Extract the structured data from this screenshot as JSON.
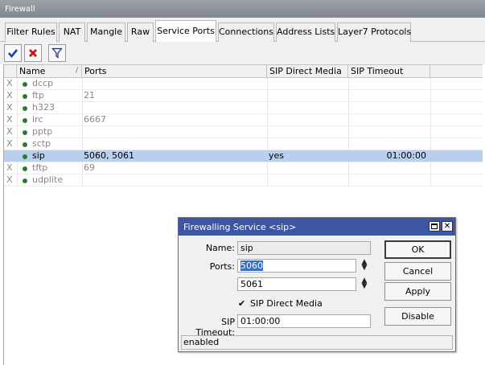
{
  "window": {
    "title": "Firewall"
  },
  "tabs": [
    {
      "label": "Filter Rules"
    },
    {
      "label": "NAT"
    },
    {
      "label": "Mangle"
    },
    {
      "label": "Raw"
    },
    {
      "label": "Service Ports",
      "active": true
    },
    {
      "label": "Connections"
    },
    {
      "label": "Address Lists"
    },
    {
      "label": "Layer7 Protocols"
    }
  ],
  "toolbar": {
    "enable_icon": "checkmark-icon",
    "disable_icon": "x-icon",
    "filter_icon": "filter-icon",
    "accent_blue": "#1f3fa8",
    "accent_red": "#c0171c"
  },
  "table": {
    "columns": [
      "Name",
      "Ports",
      "SIP Direct Media",
      "SIP Timeout"
    ],
    "sort_marker": "/",
    "rows": [
      {
        "flag": "X",
        "name": "dccp",
        "ports": "",
        "direct_media": "",
        "timeout": ""
      },
      {
        "flag": "X",
        "name": "ftp",
        "ports": "21",
        "direct_media": "",
        "timeout": ""
      },
      {
        "flag": "X",
        "name": "h323",
        "ports": "",
        "direct_media": "",
        "timeout": ""
      },
      {
        "flag": "X",
        "name": "irc",
        "ports": "6667",
        "direct_media": "",
        "timeout": ""
      },
      {
        "flag": "X",
        "name": "pptp",
        "ports": "",
        "direct_media": "",
        "timeout": ""
      },
      {
        "flag": "X",
        "name": "sctp",
        "ports": "",
        "direct_media": "",
        "timeout": ""
      },
      {
        "flag": "",
        "name": "sip",
        "ports": "5060, 5061",
        "direct_media": "yes",
        "timeout": "01:00:00",
        "selected": true
      },
      {
        "flag": "X",
        "name": "tftp",
        "ports": "69",
        "direct_media": "",
        "timeout": ""
      },
      {
        "flag": "X",
        "name": "udplite",
        "ports": "",
        "direct_media": "",
        "timeout": ""
      }
    ]
  },
  "dialog": {
    "title": "Firewalling Service <sip>",
    "name_label": "Name:",
    "name_value": "sip",
    "ports_label": "Ports:",
    "port1": "5060",
    "port2": "5061",
    "direct_media_label": "SIP Direct Media",
    "direct_media_checked": true,
    "timeout_label": "SIP Timeout:",
    "timeout_value": "01:00:00",
    "buttons": {
      "ok": "OK",
      "cancel": "Cancel",
      "apply": "Apply",
      "disable": "Disable"
    },
    "status": "enabled",
    "title_color": "#3e55a4"
  }
}
